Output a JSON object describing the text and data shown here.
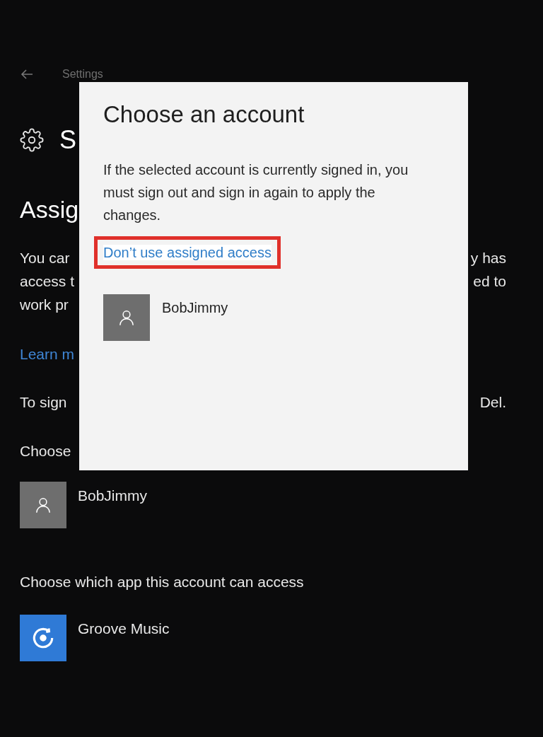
{
  "header": {
    "title": "Settings"
  },
  "page": {
    "title_fragment": "S",
    "heading_fragment": "Assig",
    "paragraph_lines": [
      {
        "left": "You car",
        "right": "y has"
      },
      {
        "left": "access t",
        "right": "ed to"
      },
      {
        "left": "work pr"
      }
    ],
    "link_fragment": "Learn m",
    "signin_line": {
      "left": "To sign",
      "right": "Del."
    },
    "choose_label": "Choose",
    "account": {
      "name": "BobJimmy"
    },
    "app_label": "Choose which app this account can access",
    "app": {
      "name": "Groove Music"
    }
  },
  "dialog": {
    "title": "Choose an account",
    "message": "If the selected account is currently signed in, you must sign out and sign in again to apply the changes.",
    "link": {
      "label": "Don’t use assigned access",
      "highlighted": true
    },
    "accounts": [
      {
        "name": "BobJimmy"
      }
    ]
  }
}
